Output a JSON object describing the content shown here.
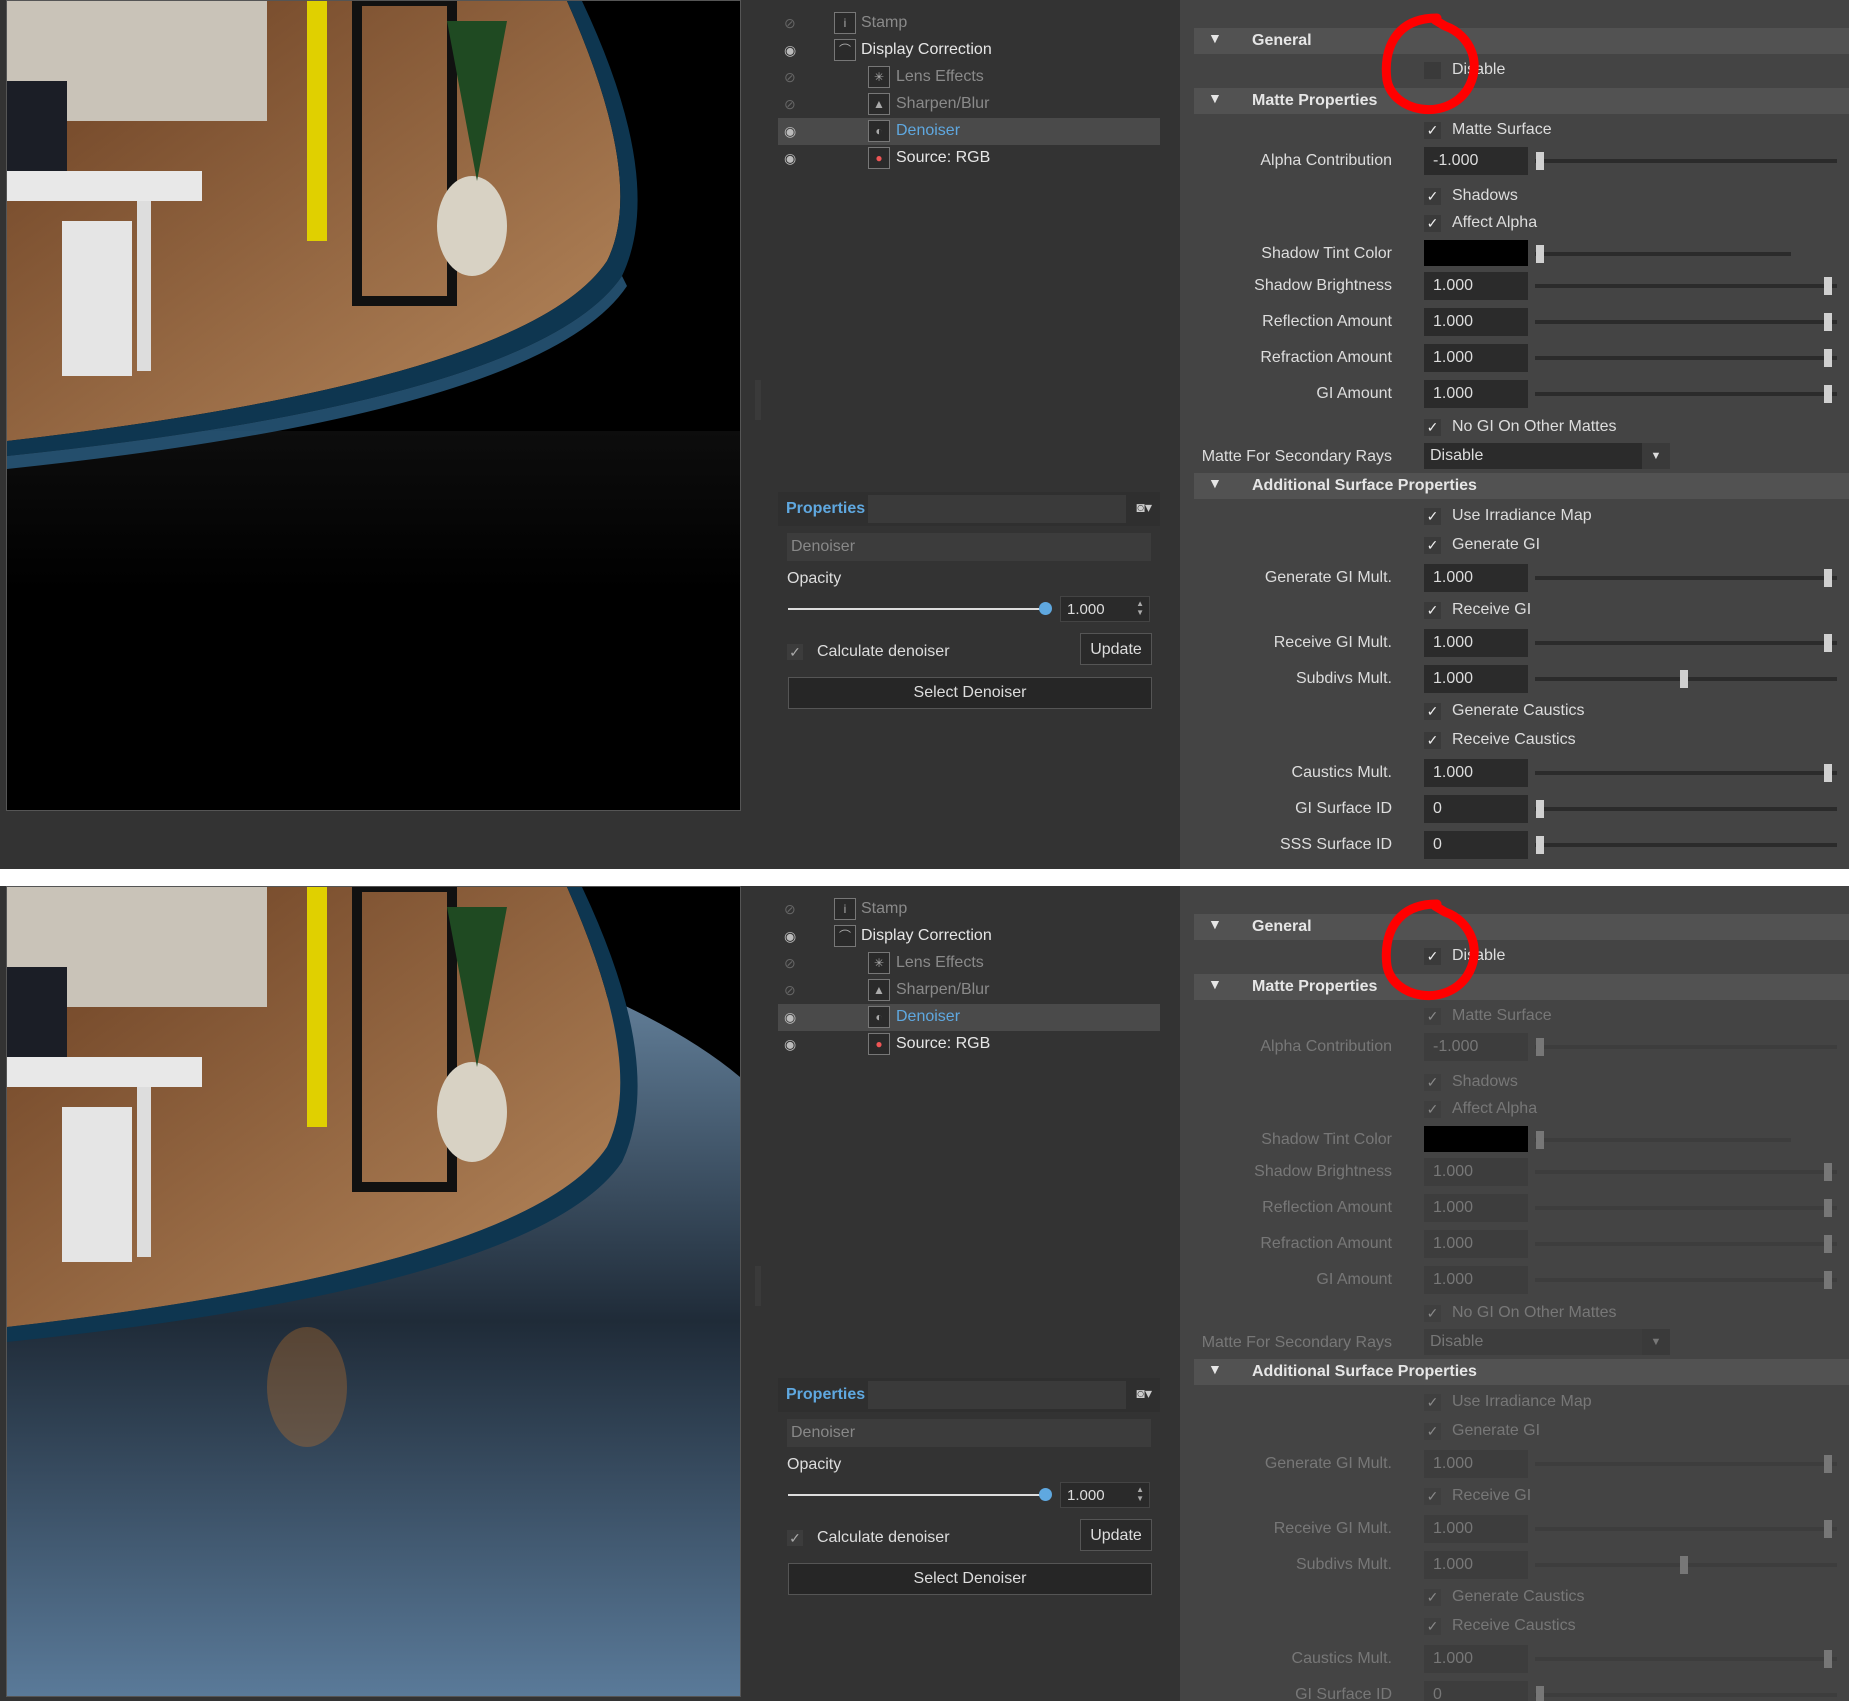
{
  "panels": [
    {
      "id": "before",
      "render": {
        "floor_color": "#000000"
      },
      "layers": [
        {
          "label": "Stamp",
          "visible": false,
          "icon": "stamp-icon"
        },
        {
          "label": "Display Correction",
          "visible": true,
          "icon": "curve-icon"
        },
        {
          "label": "Lens Effects",
          "visible": false,
          "icon": "lens-effects-icon"
        },
        {
          "label": "Sharpen/Blur",
          "visible": false,
          "icon": "sharpen-icon"
        },
        {
          "label": "Denoiser",
          "visible": true,
          "icon": "denoiser-icon",
          "selected": true
        },
        {
          "label": "Source: RGB",
          "visible": true,
          "icon": "rgb-source-icon"
        }
      ],
      "properties": {
        "title": "Properties",
        "layer_name": "Denoiser",
        "opacity_label": "Opacity",
        "opacity_value": "1.000",
        "calculate_label": "Calculate denoiser",
        "update_label": "Update",
        "select_label": "Select Denoiser"
      },
      "general": {
        "header": "General",
        "disable_label": "Disable",
        "disable_checked": false
      },
      "matte": {
        "header": "Matte Properties",
        "matte_surface": "Matte Surface",
        "alpha_label": "Alpha Contribution",
        "alpha_value": "-1.000",
        "shadows": "Shadows",
        "affect_alpha": "Affect Alpha",
        "shadow_tint": "Shadow Tint Color",
        "shadow_brightness_label": "Shadow Brightness",
        "shadow_brightness": "1.000",
        "reflection_label": "Reflection Amount",
        "reflection": "1.000",
        "refraction_label": "Refraction Amount",
        "refraction": "1.000",
        "gi_amount_label": "GI Amount",
        "gi_amount": "1.000",
        "no_gi": "No GI On Other Mattes",
        "secondary_label": "Matte For Secondary Rays",
        "secondary_value": "Disable"
      },
      "surface": {
        "header": "Additional Surface Properties",
        "use_irradiance": "Use Irradiance Map",
        "generate_gi": "Generate GI",
        "generate_gi_mult_label": "Generate GI Mult.",
        "generate_gi_mult": "1.000",
        "receive_gi": "Receive GI",
        "receive_gi_mult_label": "Receive GI Mult.",
        "receive_gi_mult": "1.000",
        "subdivs_label": "Subdivs Mult.",
        "subdivs": "1.000",
        "generate_caustics": "Generate Caustics",
        "receive_caustics": "Receive Caustics",
        "caustics_mult_label": "Caustics Mult.",
        "caustics_mult": "1.000",
        "gi_surface_id_label": "GI Surface ID",
        "gi_surface_id": "0",
        "sss_surface_id_label": "SSS Surface ID",
        "sss_surface_id": "0"
      }
    },
    {
      "id": "after",
      "render": {
        "floor_color": "#5a7a99"
      },
      "general": {
        "header": "General",
        "disable_label": "Disable",
        "disable_checked": true
      }
    }
  ],
  "colors": {
    "accent": "#5fa8e0",
    "annotation": "#ff0000",
    "panel_bg": "#444444"
  }
}
